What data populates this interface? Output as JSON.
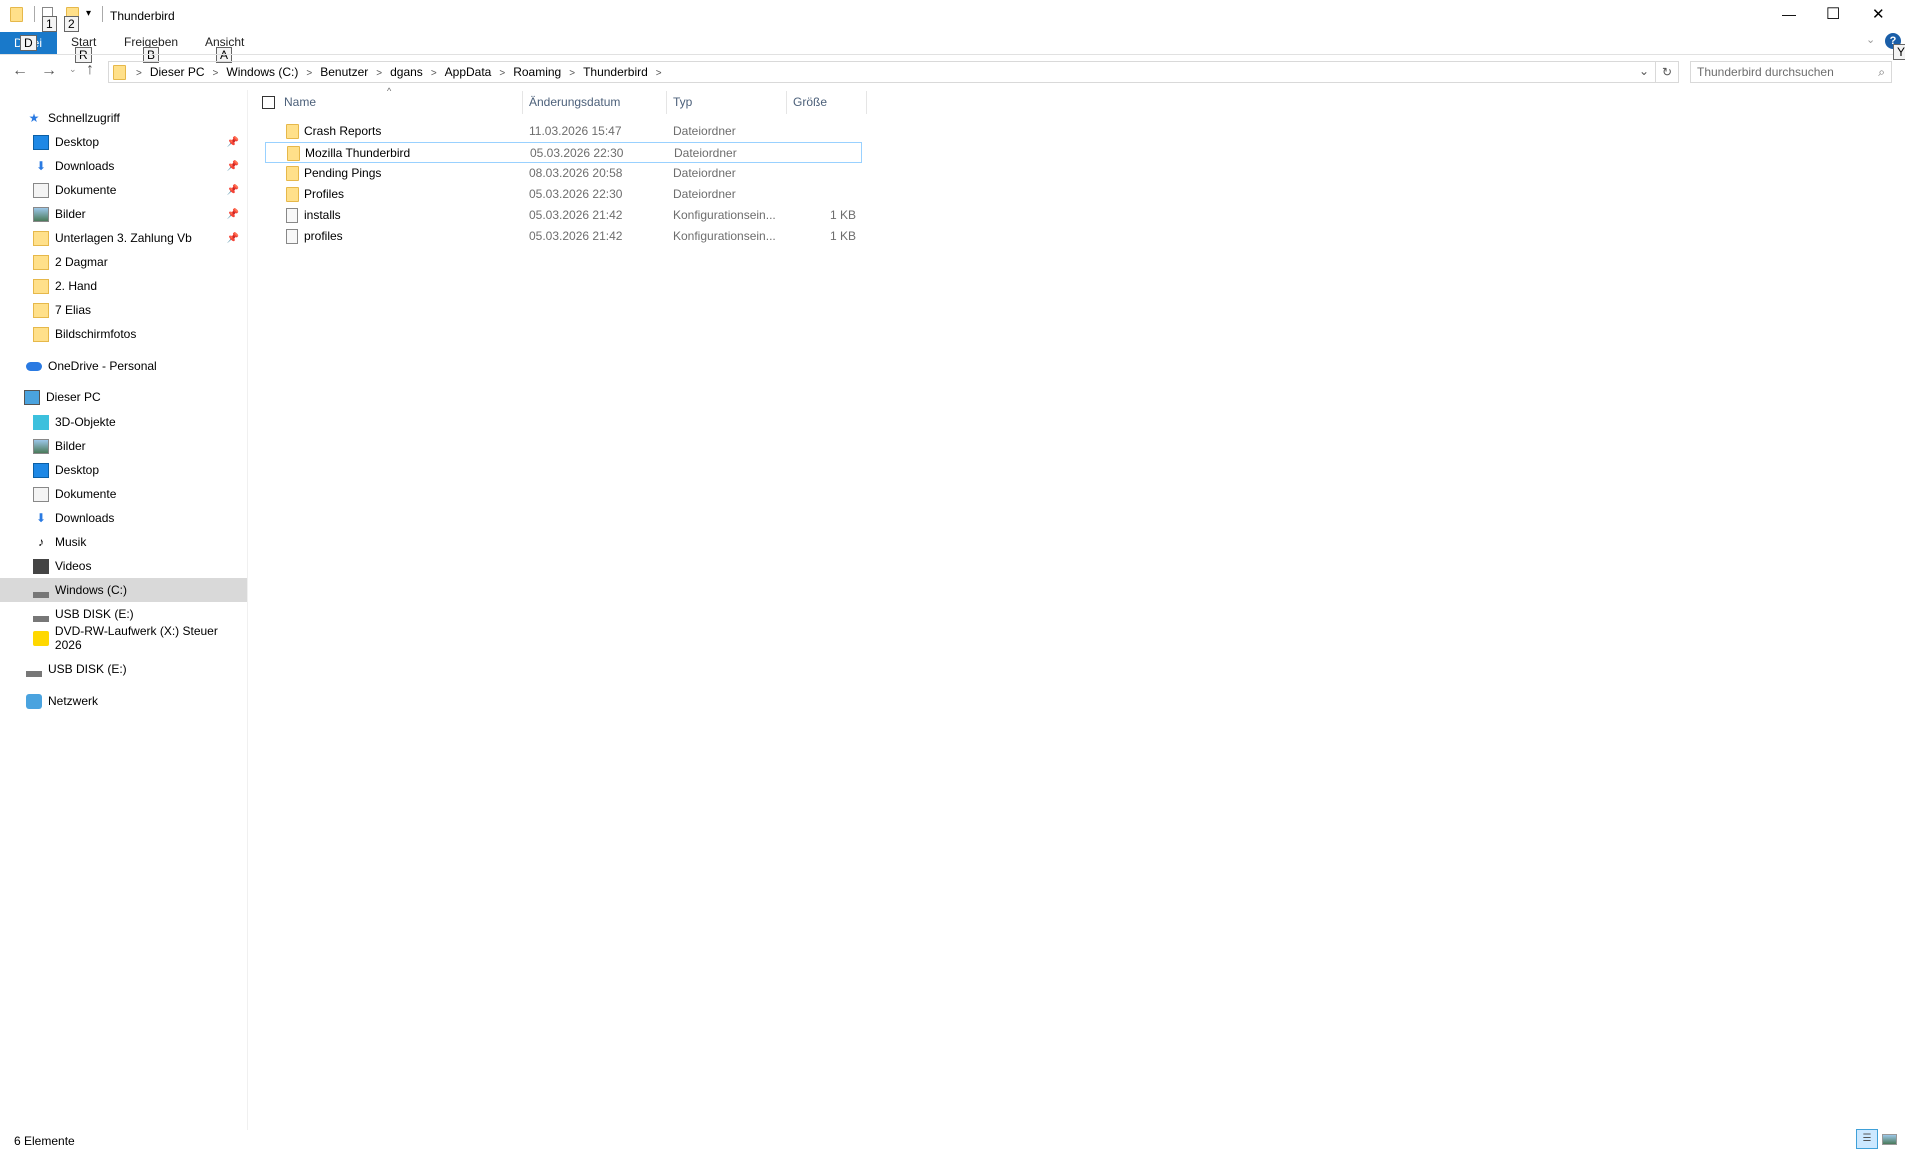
{
  "window": {
    "title": "Thunderbird",
    "controls": {
      "minimize": "—",
      "maximize": "☐",
      "close": "✕"
    }
  },
  "quick_access_toolbar": {
    "keytips": [
      "1",
      "2"
    ]
  },
  "ribbon": {
    "tabs": [
      {
        "label": "Datei",
        "keytip": "D",
        "active": true
      },
      {
        "label": "Start",
        "keytip": "R"
      },
      {
        "label": "Freigeben",
        "keytip": "B"
      },
      {
        "label": "Ansicht",
        "keytip": "A"
      }
    ],
    "help_keytip": "Y"
  },
  "address": {
    "crumbs": [
      "Dieser PC",
      "Windows (C:)",
      "Benutzer",
      "dgans",
      "AppData",
      "Roaming",
      "Thunderbird"
    ]
  },
  "search": {
    "placeholder": "Thunderbird durchsuchen"
  },
  "columns": {
    "name": "Name",
    "date": "Änderungsdatum",
    "type": "Typ",
    "size": "Größe"
  },
  "files": [
    {
      "name": "Crash Reports",
      "date": "11.03.2026 15:47",
      "type": "Dateiordner",
      "size": "",
      "kind": "folder"
    },
    {
      "name": "Mozilla Thunderbird",
      "date": "05.03.2026 22:30",
      "type": "Dateiordner",
      "size": "",
      "kind": "folder",
      "selected": true
    },
    {
      "name": "Pending Pings",
      "date": "08.03.2026 20:58",
      "type": "Dateiordner",
      "size": "",
      "kind": "folder"
    },
    {
      "name": "Profiles",
      "date": "05.03.2026 22:30",
      "type": "Dateiordner",
      "size": "",
      "kind": "folder"
    },
    {
      "name": "installs",
      "date": "05.03.2026 21:42",
      "type": "Konfigurationsein...",
      "size": "1 KB",
      "kind": "config"
    },
    {
      "name": "profiles",
      "date": "05.03.2026 21:42",
      "type": "Konfigurationsein...",
      "size": "1 KB",
      "kind": "config"
    }
  ],
  "sidebar": {
    "quick_access": "Schnellzugriff",
    "quick_items": [
      "Desktop",
      "Downloads",
      "Dokumente",
      "Bilder",
      "Unterlagen 3. Zahlung Vb",
      "2 Dagmar",
      "2. Hand",
      "7 Elias",
      "Bildschirmfotos"
    ],
    "onedrive": "OneDrive - Personal",
    "this_pc": "Dieser PC",
    "pc_items": [
      "3D-Objekte",
      "Bilder",
      "Desktop",
      "Dokumente",
      "Downloads",
      "Musik",
      "Videos",
      "Windows (C:)",
      "USB DISK (E:)",
      "DVD-RW-Laufwerk (X:) Steuer 2026"
    ],
    "usb": "USB DISK (E:)",
    "network": "Netzwerk"
  },
  "status": {
    "count": "6 Elemente"
  },
  "colors": {
    "accent": "#1979ca",
    "selection_border": "#99d1ff",
    "nav_selected": "#d9d9d9"
  }
}
